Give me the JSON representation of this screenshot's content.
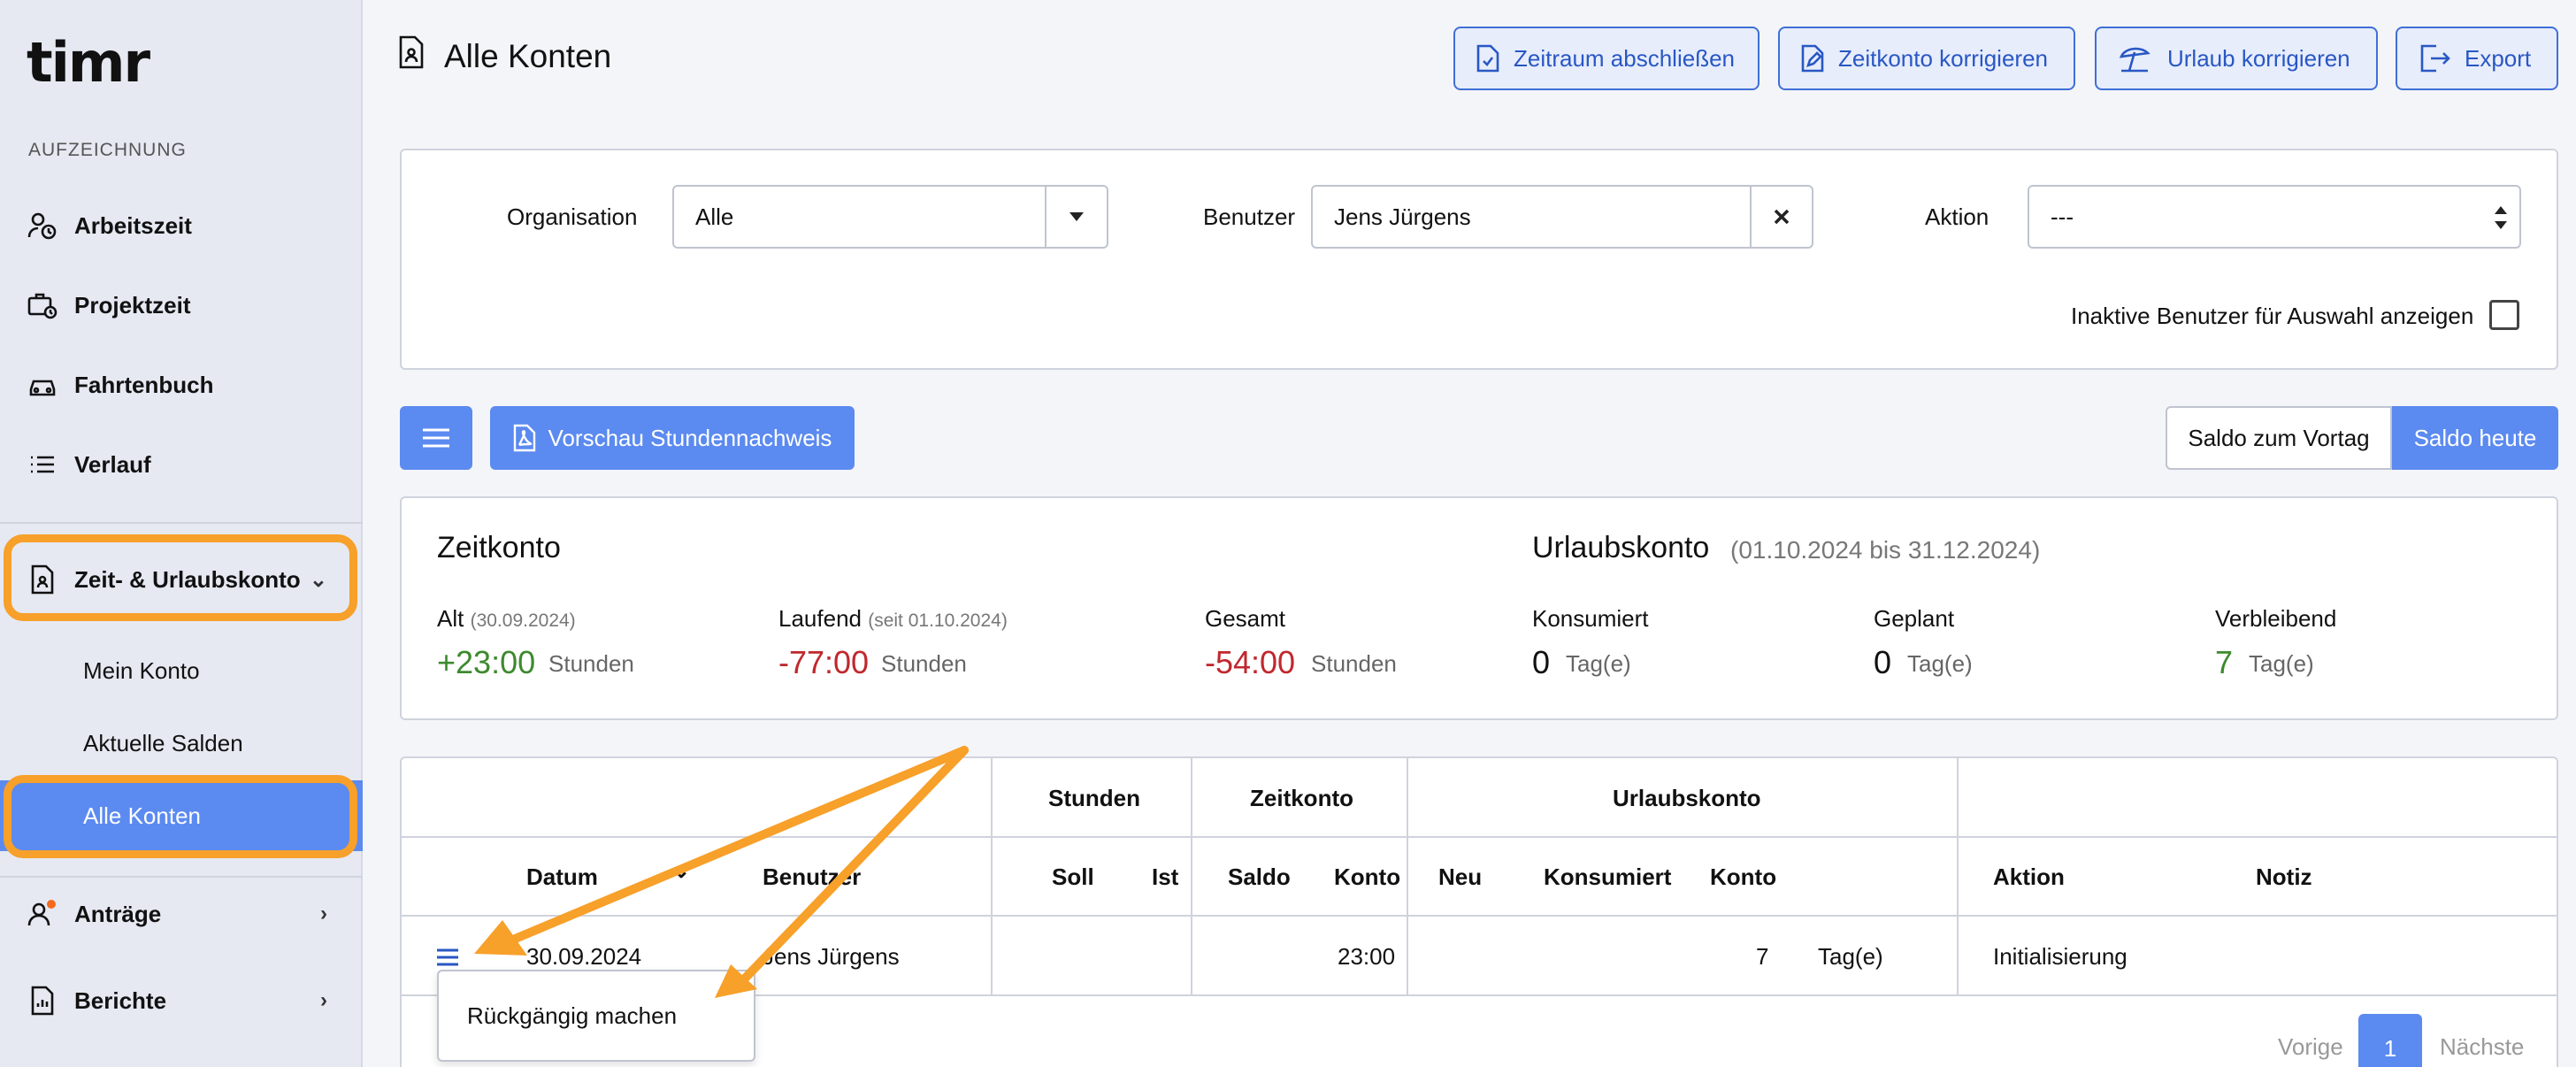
{
  "app": {
    "logo": "timr"
  },
  "sidebar": {
    "section_label": "AUFZEICHNUNG",
    "items": [
      {
        "label": "Arbeitszeit",
        "icon": "user-clock-icon"
      },
      {
        "label": "Projektzeit",
        "icon": "briefcase-clock-icon"
      },
      {
        "label": "Fahrtenbuch",
        "icon": "car-icon"
      },
      {
        "label": "Verlauf",
        "icon": "list-icon"
      },
      {
        "label": "Zeit- & Urlaubskonto",
        "icon": "document-icon"
      },
      {
        "label": "Anträge",
        "icon": "user-badge-icon"
      },
      {
        "label": "Berichte",
        "icon": "report-icon"
      }
    ],
    "sub_items": [
      "Mein Konto",
      "Aktuelle Salden",
      "Alle Konten"
    ]
  },
  "header": {
    "title": "Alle Konten",
    "buttons": [
      "Zeitraum abschließen",
      "Zeitkonto korrigieren",
      "Urlaub korrigieren",
      "Export"
    ]
  },
  "filters": {
    "organisation_label": "Organisation",
    "organisation_value": "Alle",
    "benutzer_label": "Benutzer",
    "benutzer_value": "Jens Jürgens",
    "aktion_label": "Aktion",
    "aktion_value": "---",
    "inactive_label": "Inaktive Benutzer für Auswahl anzeigen"
  },
  "actions": {
    "preview_label": "Vorschau Stundennachweis",
    "saldo_vortag": "Saldo zum Vortag",
    "saldo_heute": "Saldo heute"
  },
  "summary": {
    "zeitkonto_title": "Zeitkonto",
    "urlaubskonto_title": "Urlaubskonto",
    "urlaubskonto_range": "(01.10.2024 bis 31.12.2024)",
    "alt_label": "Alt",
    "alt_date": "(30.09.2024)",
    "alt_value": "+23:00",
    "laufend_label": "Laufend",
    "laufend_date": "(seit 01.10.2024)",
    "laufend_value": "-77:00",
    "gesamt_label": "Gesamt",
    "gesamt_value": "-54:00",
    "stunden_unit": "Stunden",
    "konsumiert_label": "Konsumiert",
    "konsumiert_value": "0",
    "geplant_label": "Geplant",
    "geplant_value": "0",
    "verbleibend_label": "Verbleibend",
    "verbleibend_value": "7",
    "tage_unit": "Tag(e)",
    "colors": {
      "positive": "#3d8a2e",
      "negative": "#c0282d"
    }
  },
  "table": {
    "group_headers": {
      "stunden": "Stunden",
      "zeitkonto": "Zeitkonto",
      "urlaubskonto": "Urlaubskonto"
    },
    "columns": {
      "datum": "Datum",
      "benutzer": "Benutzer",
      "soll": "Soll",
      "ist": "Ist",
      "saldo": "Saldo",
      "konto": "Konto",
      "neu": "Neu",
      "konsumiert": "Konsumiert",
      "u_konto": "Konto",
      "aktion": "Aktion",
      "notiz": "Notiz"
    },
    "rows": [
      {
        "datum": "30.09.2024",
        "benutzer": "Jens Jürgens",
        "konto": "23:00",
        "u_konto": "7",
        "unit": "Tag(e)",
        "aktion": "Initialisierung"
      }
    ],
    "row_menu_item": "Rückgängig machen"
  },
  "pagination": {
    "prev": "Vorige",
    "page": "1",
    "next": "Nächste"
  }
}
